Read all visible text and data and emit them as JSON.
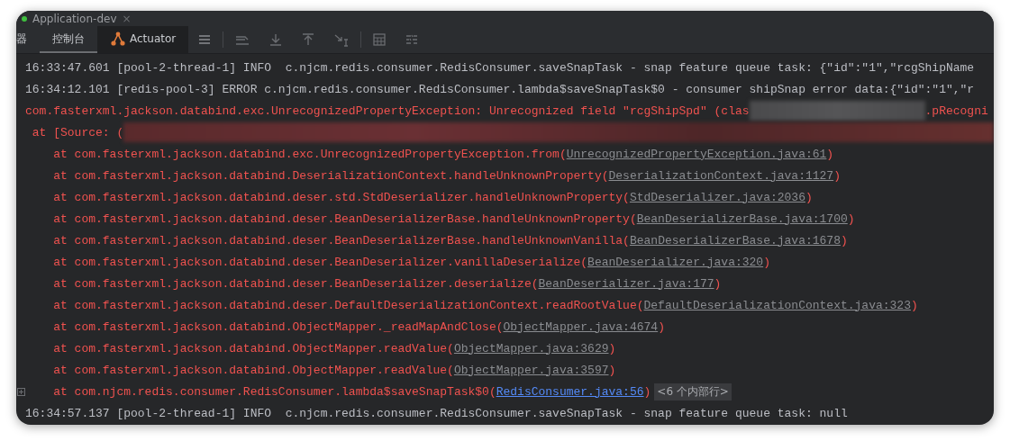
{
  "window": {
    "title": "Application-dev",
    "close": "×"
  },
  "tabs": [
    {
      "label": "器",
      "selected": false,
      "kind": "text"
    },
    {
      "label": "控制台",
      "selected": true,
      "kind": "text"
    },
    {
      "label": "Actuator",
      "selected": false,
      "kind": "actuator"
    }
  ],
  "console": {
    "lines": [
      {
        "kind": "log",
        "text": "16:33:47.601 [pool-2-thread-1] INFO  c.njcm.redis.consumer.RedisConsumer.saveSnapTask - snap feature queue task: {\"id\":\"1\",\"rcgShipName"
      },
      {
        "kind": "log",
        "text": "16:34:12.101 [redis-pool-3] ERROR c.njcm.redis.consumer.RedisConsumer.lambda$saveSnapTask$0 - consumer shipSnap error data:{\"id\":\"1\",\"r"
      },
      {
        "kind": "error_redacted_mid",
        "text": "com.fasterxml.jackson.databind.exc.UnrecognizedPropertyException: Unrecognized field \"rcgShipSpd\" (clas",
        "after": ".pRecogni"
      },
      {
        "kind": "error_redacted_end",
        "text": " at [Source: ("
      },
      {
        "kind": "frame",
        "call": "at com.fasterxml.jackson.databind.exc.UnrecognizedPropertyException.from(",
        "link": "UnrecognizedPropertyException.java:61",
        "link_active": false,
        "tail": ")"
      },
      {
        "kind": "frame",
        "call": "at com.fasterxml.jackson.databind.DeserializationContext.handleUnknownProperty(",
        "link": "DeserializationContext.java:1127",
        "link_active": false,
        "tail": ")"
      },
      {
        "kind": "frame",
        "call": "at com.fasterxml.jackson.databind.deser.std.StdDeserializer.handleUnknownProperty(",
        "link": "StdDeserializer.java:2036",
        "link_active": false,
        "tail": ")"
      },
      {
        "kind": "frame",
        "call": "at com.fasterxml.jackson.databind.deser.BeanDeserializerBase.handleUnknownProperty(",
        "link": "BeanDeserializerBase.java:1700",
        "link_active": false,
        "tail": ")"
      },
      {
        "kind": "frame",
        "call": "at com.fasterxml.jackson.databind.deser.BeanDeserializerBase.handleUnknownVanilla(",
        "link": "BeanDeserializerBase.java:1678",
        "link_active": false,
        "tail": ")"
      },
      {
        "kind": "frame",
        "call": "at com.fasterxml.jackson.databind.deser.BeanDeserializer.vanillaDeserialize(",
        "link": "BeanDeserializer.java:320",
        "link_active": false,
        "tail": ")"
      },
      {
        "kind": "frame",
        "call": "at com.fasterxml.jackson.databind.deser.BeanDeserializer.deserialize(",
        "link": "BeanDeserializer.java:177",
        "link_active": false,
        "tail": ")"
      },
      {
        "kind": "frame",
        "call": "at com.fasterxml.jackson.databind.deser.DefaultDeserializationContext.readRootValue(",
        "link": "DefaultDeserializationContext.java:323",
        "link_active": false,
        "tail": ")"
      },
      {
        "kind": "frame",
        "call": "at com.fasterxml.jackson.databind.ObjectMapper._readMapAndClose(",
        "link": "ObjectMapper.java:4674",
        "link_active": false,
        "tail": ")"
      },
      {
        "kind": "frame",
        "call": "at com.fasterxml.jackson.databind.ObjectMapper.readValue(",
        "link": "ObjectMapper.java:3629",
        "link_active": false,
        "tail": ")"
      },
      {
        "kind": "frame",
        "call": "at com.fasterxml.jackson.databind.ObjectMapper.readValue(",
        "link": "ObjectMapper.java:3597",
        "link_active": false,
        "tail": ")"
      },
      {
        "kind": "frame",
        "call": "at com.njcm.redis.consumer.RedisConsumer.lambda$saveSnapTask$0(",
        "link": "RedisConsumer.java:56",
        "link_active": true,
        "tail": ")",
        "folded_note": "<6 个内部行>"
      },
      {
        "kind": "log",
        "text": "16:34:57.137 [pool-2-thread-1] INFO  c.njcm.redis.consumer.RedisConsumer.saveSnapTask - snap feature queue task: null"
      }
    ]
  }
}
